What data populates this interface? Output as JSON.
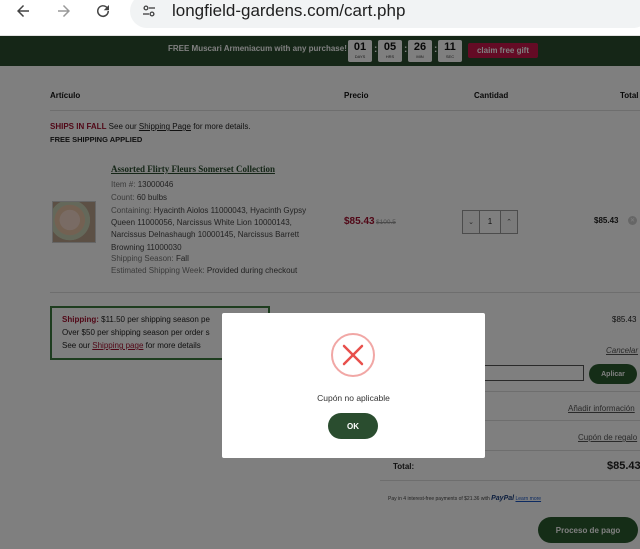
{
  "browser": {
    "url": "longfield-gardens.com/cart.php"
  },
  "promo": {
    "text": "FREE Muscari Armeniacum with any purchase!",
    "timer": [
      {
        "value": "01",
        "label": "DAYS"
      },
      {
        "value": "05",
        "label": "HRS"
      },
      {
        "value": "26",
        "label": "MIN"
      },
      {
        "value": "11",
        "label": "SEC"
      }
    ],
    "claim_label": "claim free gift",
    "claim_color": "#c8174b",
    "bg_color": "#2a4d2f"
  },
  "cart": {
    "headers": {
      "item": "Artículo",
      "price": "Precio",
      "quantity": "Cantidad",
      "total": "Total"
    },
    "ships_notice": {
      "red": "SHIPS IN FALL",
      "pre": " See our ",
      "link": "Shipping Page",
      "post": " for more details."
    },
    "free_shipping": "FREE SHIPPING APPLIED",
    "product": {
      "title": "Assorted Flirty Fleurs Somerset Collection",
      "item_label": "Item #:",
      "item_value": "13000046",
      "count_label": "Count:",
      "count_value": "60 bulbs",
      "containing_label": "Containing:",
      "containing_value": "Hyacinth Aiolos 11000043, Hyacinth Gypsy Queen 11000056, Narcissus White Lion 10000143, Narcissus Delnashaugh 10000145, Narcissus Barrett Browning 11000030",
      "season_label": "Shipping Season:",
      "season_value": "Fall",
      "week_label": "Estimated Shipping Week:",
      "week_value": "Provided during checkout",
      "price": "$85.43",
      "price_was": "$100.5",
      "quantity": "1",
      "row_total": "$85.43"
    },
    "shipping_box": {
      "label": "Shipping:",
      "line1": " $11.50  per shipping season pe",
      "line2": "Over $50 per shipping season per order s",
      "line3_pre": "See our ",
      "line3_link": "Shipping page",
      "line3_post": " for more details"
    },
    "summary": {
      "subtotal": "$85.43",
      "cancel": "Cancelar",
      "apply": "Aplicar",
      "add_info": "Añadir información",
      "gift_coupon": "Cupón de regalo",
      "total_label": "Total:",
      "total_value": "$85.43",
      "paypal_text": "Pay in 4 interest-free payments of $21.36 with",
      "paypal_brand": "PayPal",
      "paypal_learn": "Learn more",
      "checkout": "Proceso de pago"
    }
  },
  "modal": {
    "message": "Cupón no aplicable",
    "ok_label": "OK",
    "icon": "error-x-icon",
    "icon_color": "#e8504c"
  }
}
